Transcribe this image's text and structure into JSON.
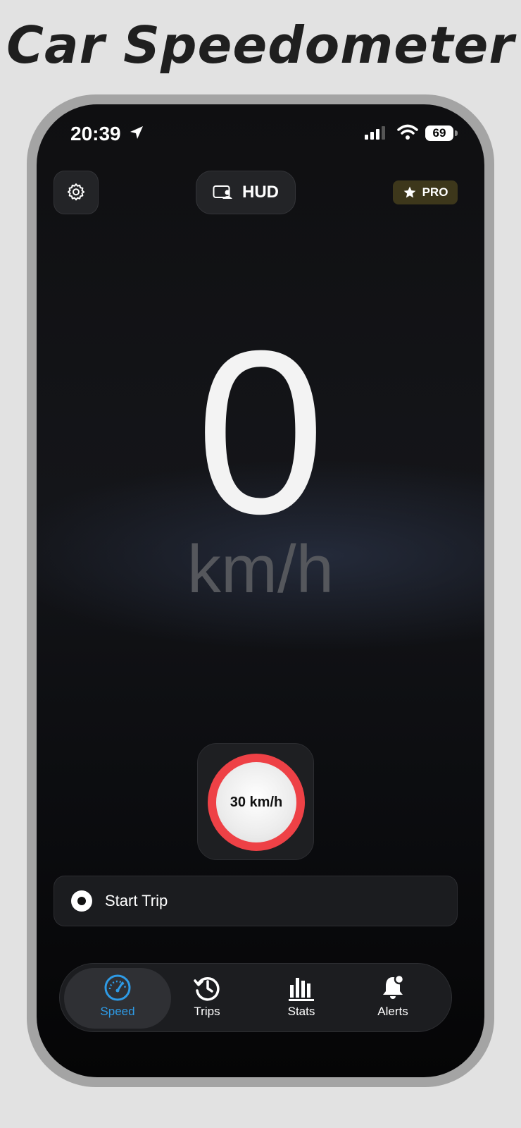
{
  "page_title": "Car Speedometer",
  "status_bar": {
    "time": "20:39",
    "battery": "69"
  },
  "header": {
    "hud_label": "HUD",
    "pro_label": "PRO"
  },
  "speed": {
    "value": "0",
    "unit": "km/h"
  },
  "speed_limit": {
    "label": "30 km/h"
  },
  "trip": {
    "start_label": "Start Trip"
  },
  "tab_bar": {
    "tabs": [
      {
        "label": "Speed",
        "icon": "speedometer-icon",
        "active": true
      },
      {
        "label": "Trips",
        "icon": "history-icon",
        "active": false
      },
      {
        "label": "Stats",
        "icon": "bar-chart-icon",
        "active": false
      },
      {
        "label": "Alerts",
        "icon": "bell-icon",
        "active": false
      }
    ]
  },
  "colors": {
    "accent": "#2e9be6",
    "limit_red": "#ee4146",
    "pro_badge": "#3d371b"
  }
}
